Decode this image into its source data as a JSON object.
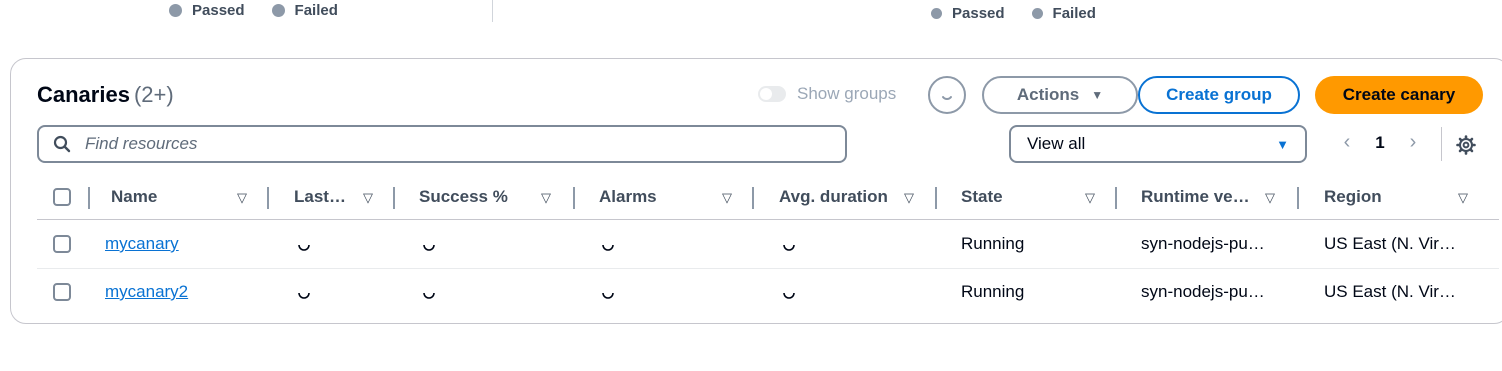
{
  "top_legends": [
    {
      "passed": "Passed",
      "failed": "Failed"
    },
    {
      "passed": "Passed",
      "failed": "Failed"
    }
  ],
  "card": {
    "title": "Canaries",
    "count": "(2+)",
    "show_groups_label": "Show groups",
    "actions_label": "Actions",
    "create_group_label": "Create group",
    "create_canary_label": "Create canary",
    "search_placeholder": "Find resources",
    "filter_selected": "View all",
    "page_number": "1"
  },
  "table": {
    "columns": [
      "Name",
      "Last…",
      "Success %",
      "Alarms",
      "Avg. duration",
      "State",
      "Runtime ve…",
      "Region"
    ],
    "rows": [
      {
        "name": "mycanary",
        "state": "Running",
        "runtime": "syn-nodejs-pu…",
        "region": "US East (N. Vir…"
      },
      {
        "name": "mycanary2",
        "state": "Running",
        "runtime": "syn-nodejs-pu…",
        "region": "US East (N. Vir…"
      }
    ]
  },
  "colors": {
    "primary": "#0972d3",
    "accent": "#ff9900",
    "border": "#8d99a8"
  }
}
